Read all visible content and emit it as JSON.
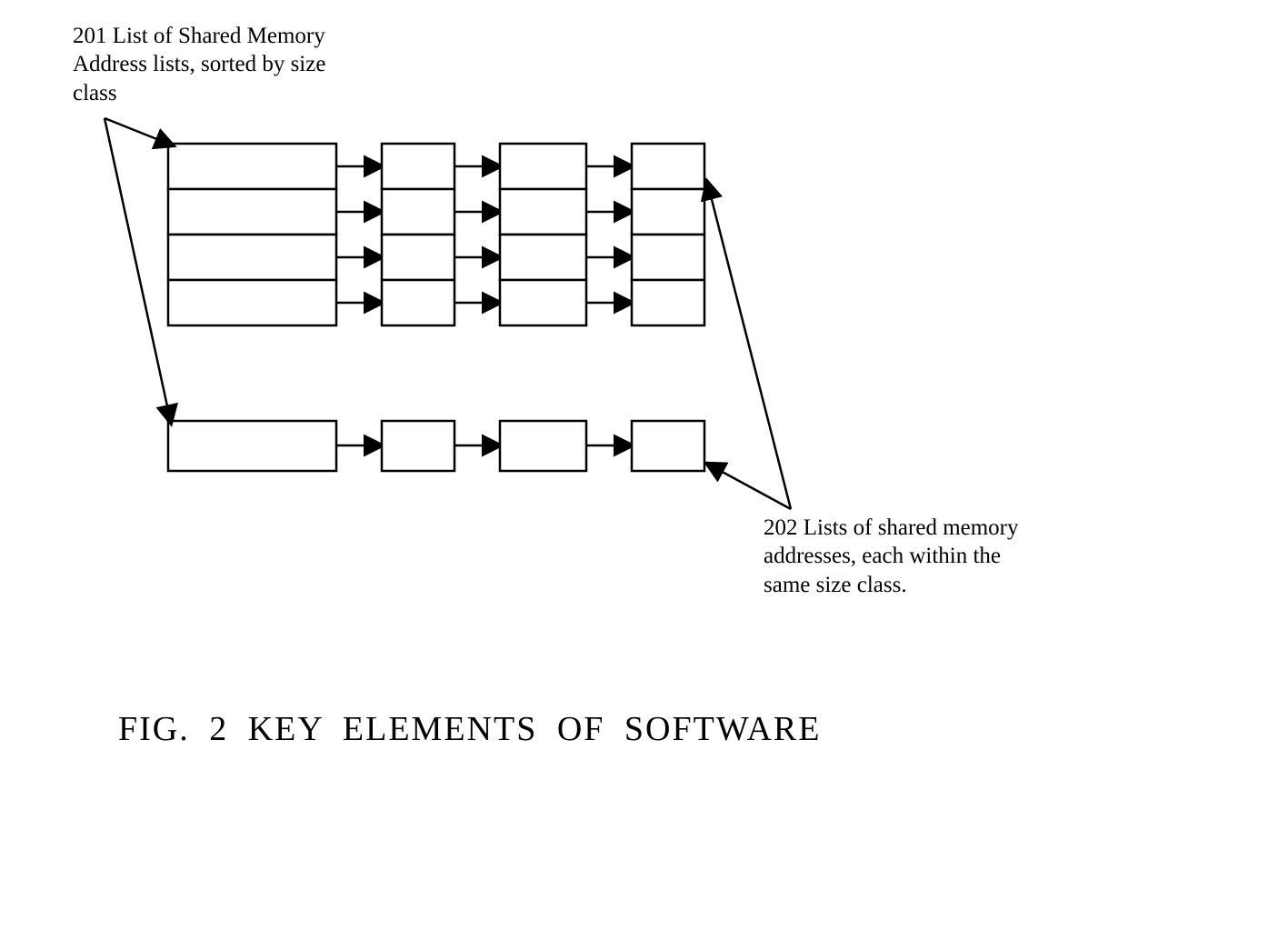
{
  "labels": {
    "l201_line1": "201 List of Shared Memory",
    "l201_line2": "Address lists, sorted by size",
    "l201_line3": "class",
    "l202_line1": "202 Lists of shared memory",
    "l202_line2": "addresses, each within the",
    "l202_line3": "same size class."
  },
  "figure_title": "FIG. 2   KEY ELEMENTS OF SOFTWARE",
  "diagram": {
    "description": "Linked-list style data structure diagram showing two groups of horizontal chains of rectangular nodes connected by right-pointing arrows, with two multi-headed leader lines from textual labels 201 and 202.",
    "size_class_list_heads": 4,
    "chain_nodes_per_row": 4,
    "bottom_chain_nodes": 4
  }
}
